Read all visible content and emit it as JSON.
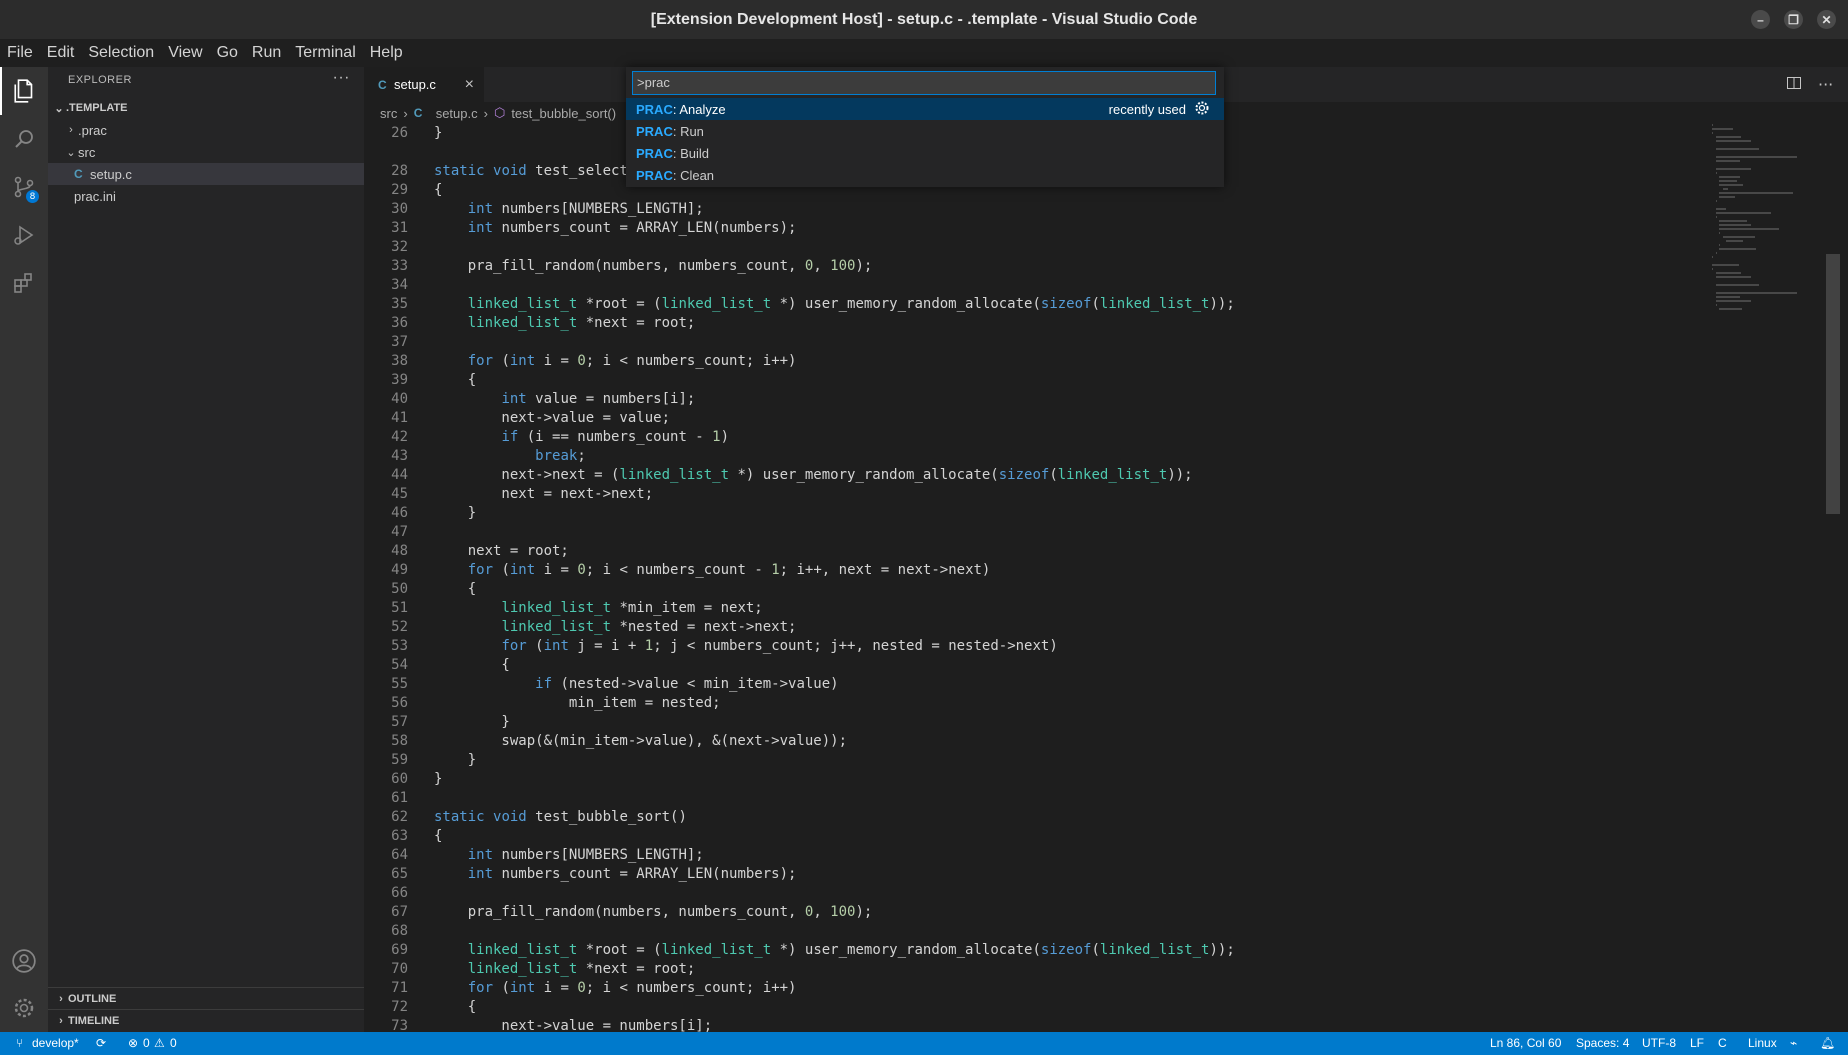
{
  "window": {
    "title": "[Extension Development Host] - setup.c - .template - Visual Studio Code"
  },
  "menu": [
    "File",
    "Edit",
    "Selection",
    "View",
    "Go",
    "Run",
    "Terminal",
    "Help"
  ],
  "activity_bar": {
    "scm_badge": "8"
  },
  "explorer": {
    "header": "EXPLORER",
    "more": "···",
    "root": ".TEMPLATE",
    "items": [
      {
        "label": ".prac",
        "type": "folder-collapsed"
      },
      {
        "label": "src",
        "type": "folder-expanded"
      },
      {
        "label": "setup.c",
        "type": "c-file"
      },
      {
        "label": "prac.ini",
        "type": "file"
      }
    ],
    "outline": "OUTLINE",
    "timeline": "TIMELINE"
  },
  "tab": {
    "label": "setup.c",
    "icon": "C",
    "close": "×"
  },
  "breadcrumb": {
    "folder": "src",
    "file": "setup.c",
    "symbol": "test_bubble_sort()"
  },
  "command_palette": {
    "input": ">prac",
    "items": [
      {
        "prefix": "PRAC",
        "label": ": Analyze",
        "hint": "recently used"
      },
      {
        "prefix": "PRAC",
        "label": ": Run",
        "hint": ""
      },
      {
        "prefix": "PRAC",
        "label": ": Build",
        "hint": ""
      },
      {
        "prefix": "PRAC",
        "label": ": Clean",
        "hint": ""
      }
    ]
  },
  "code": [
    {
      "n": "26",
      "t": "}"
    },
    {
      "n": "28",
      "t": "static void test_select"
    },
    {
      "n": "29",
      "t": "{"
    },
    {
      "n": "30",
      "t": "    int numbers[NUMBERS_LENGTH];"
    },
    {
      "n": "31",
      "t": "    int numbers_count = ARRAY_LEN(numbers);"
    },
    {
      "n": "32",
      "t": ""
    },
    {
      "n": "33",
      "t": "    pra_fill_random(numbers, numbers_count, 0, 100);"
    },
    {
      "n": "34",
      "t": ""
    },
    {
      "n": "35",
      "t": "    linked_list_t *root = (linked_list_t *) user_memory_random_allocate(sizeof(linked_list_t));"
    },
    {
      "n": "36",
      "t": "    linked_list_t *next = root;"
    },
    {
      "n": "37",
      "t": ""
    },
    {
      "n": "38",
      "t": "    for (int i = 0; i < numbers_count; i++)"
    },
    {
      "n": "39",
      "t": "    {"
    },
    {
      "n": "40",
      "t": "        int value = numbers[i];"
    },
    {
      "n": "41",
      "t": "        next->value = value;"
    },
    {
      "n": "42",
      "t": "        if (i == numbers_count - 1)"
    },
    {
      "n": "43",
      "t": "            break;"
    },
    {
      "n": "44",
      "t": "        next->next = (linked_list_t *) user_memory_random_allocate(sizeof(linked_list_t));"
    },
    {
      "n": "45",
      "t": "        next = next->next;"
    },
    {
      "n": "46",
      "t": "    }"
    },
    {
      "n": "47",
      "t": ""
    },
    {
      "n": "48",
      "t": "    next = root;"
    },
    {
      "n": "49",
      "t": "    for (int i = 0; i < numbers_count - 1; i++, next = next->next)"
    },
    {
      "n": "50",
      "t": "    {"
    },
    {
      "n": "51",
      "t": "        linked_list_t *min_item = next;"
    },
    {
      "n": "52",
      "t": "        linked_list_t *nested = next->next;"
    },
    {
      "n": "53",
      "t": "        for (int j = i + 1; j < numbers_count; j++, nested = nested->next)"
    },
    {
      "n": "54",
      "t": "        {"
    },
    {
      "n": "55",
      "t": "            if (nested->value < min_item->value)"
    },
    {
      "n": "56",
      "t": "                min_item = nested;"
    },
    {
      "n": "57",
      "t": "        }"
    },
    {
      "n": "58",
      "t": "        swap(&(min_item->value), &(next->value));"
    },
    {
      "n": "59",
      "t": "    }"
    },
    {
      "n": "60",
      "t": "}"
    },
    {
      "n": "61",
      "t": ""
    },
    {
      "n": "62",
      "t": "static void test_bubble_sort()"
    },
    {
      "n": "63",
      "t": "{"
    },
    {
      "n": "64",
      "t": "    int numbers[NUMBERS_LENGTH];"
    },
    {
      "n": "65",
      "t": "    int numbers_count = ARRAY_LEN(numbers);"
    },
    {
      "n": "66",
      "t": ""
    },
    {
      "n": "67",
      "t": "    pra_fill_random(numbers, numbers_count, 0, 100);"
    },
    {
      "n": "68",
      "t": ""
    },
    {
      "n": "69",
      "t": "    linked_list_t *root = (linked_list_t *) user_memory_random_allocate(sizeof(linked_list_t));"
    },
    {
      "n": "70",
      "t": "    linked_list_t *next = root;"
    },
    {
      "n": "71",
      "t": "    for (int i = 0; i < numbers_count; i++)"
    },
    {
      "n": "72",
      "t": "    {"
    },
    {
      "n": "73",
      "t": "        next->value = numbers[i];"
    }
  ],
  "status": {
    "branch": "develop*",
    "errors": "0",
    "warnings": "0",
    "position": "Ln 86, Col 60",
    "spaces": "Spaces: 4",
    "encoding": "UTF-8",
    "eol": "LF",
    "language": "C",
    "os": "Linux"
  },
  "colors": {
    "accent": "#007acc",
    "palette_selected": "#04395e",
    "palette_highlight": "#2aaaff"
  }
}
